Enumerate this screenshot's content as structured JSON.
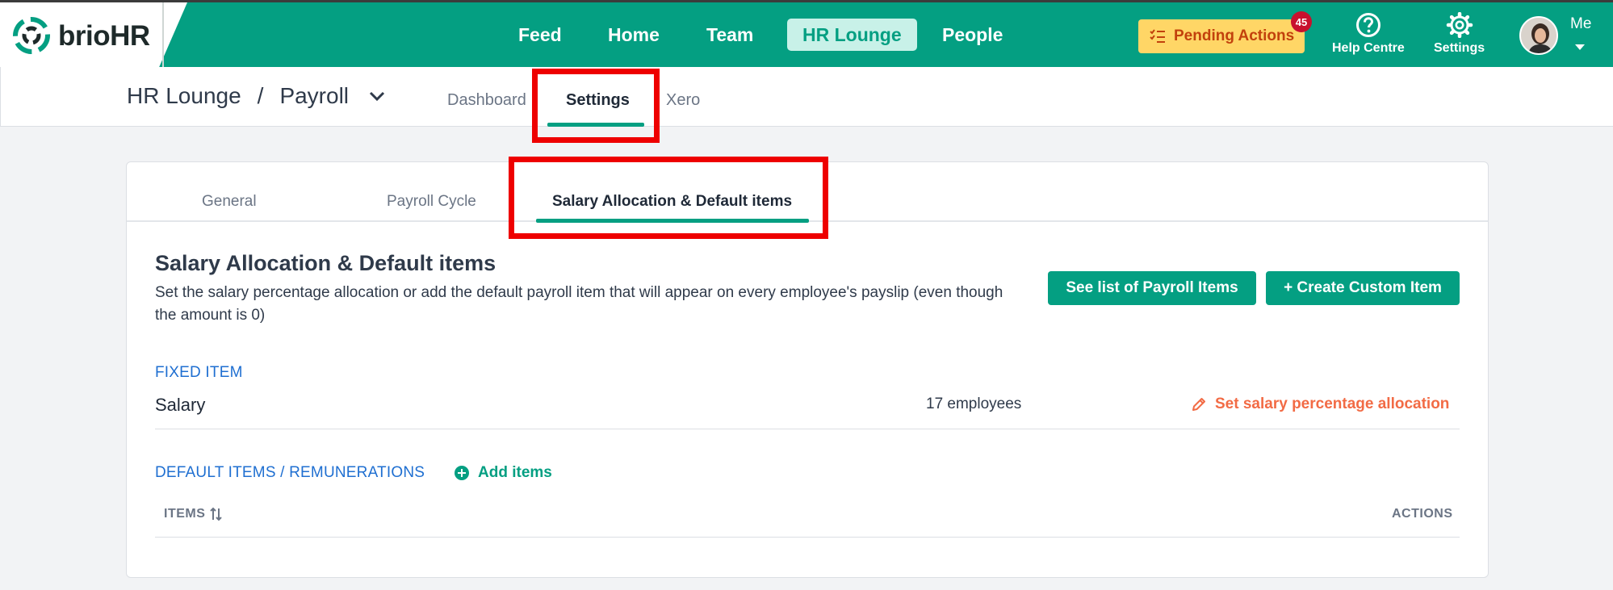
{
  "brand": {
    "name_a": "brio",
    "name_b": "HR",
    "colors": {
      "primary": "#049f82",
      "accent_orange": "#f26b45",
      "link_blue": "#1f6fd1",
      "pending_bg": "#ffd666",
      "badge_red": "#c8102e",
      "highlight_red": "#ee0000"
    }
  },
  "topnav": {
    "items": [
      {
        "label": "Feed"
      },
      {
        "label": "Home"
      },
      {
        "label": "Team"
      },
      {
        "label": "HR Lounge",
        "active": true
      },
      {
        "label": "People"
      }
    ],
    "pending": {
      "label": "Pending Actions",
      "badge": "45",
      "icon": "checklist-icon"
    },
    "help": {
      "label": "Help Centre",
      "icon": "question-circle-icon"
    },
    "settings": {
      "label": "Settings",
      "icon": "gear-icon"
    },
    "user": {
      "label": "Me",
      "icon": "avatar"
    }
  },
  "subheader": {
    "breadcrumb_root": "HR Lounge",
    "breadcrumb_sep": "/",
    "breadcrumb_current": "Payroll",
    "tabs": [
      {
        "label": "Dashboard"
      },
      {
        "label": "Settings",
        "active": true
      },
      {
        "label": "Xero"
      }
    ]
  },
  "card": {
    "tabs": [
      {
        "label": "General"
      },
      {
        "label": "Payroll Cycle"
      },
      {
        "label": "Salary Allocation & Default items",
        "active": true
      }
    ],
    "title": "Salary Allocation & Default items",
    "description": "Set the salary percentage allocation or add the default payroll item that will appear on every employee's payslip (even though the amount is 0)",
    "buttons": {
      "see_list": "See list of Payroll Items",
      "create_custom": "+ Create Custom Item"
    },
    "fixed_item": {
      "heading": "FIXED ITEM",
      "name": "Salary",
      "count": "17 employees",
      "action": "Set salary percentage allocation"
    },
    "default_items": {
      "heading": "DEFAULT ITEMS / REMUNERATIONS",
      "add_label": "Add items",
      "columns": {
        "items": "ITEMS",
        "actions": "ACTIONS"
      }
    }
  }
}
